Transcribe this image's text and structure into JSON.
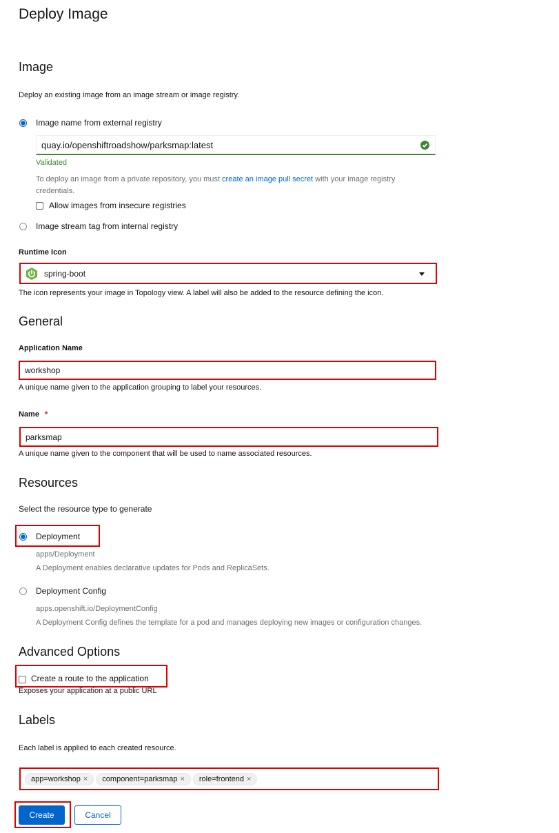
{
  "page": {
    "title": "Deploy Image"
  },
  "image_section": {
    "heading": "Image",
    "description": "Deploy an existing image from an image stream or image registry.",
    "option_external": {
      "label": "Image name from external registry",
      "selected": true
    },
    "image_input": {
      "value": "quay.io/openshiftroadshow/parksmap:latest",
      "status_icon": "check-circle-icon"
    },
    "validated_text": "Validated",
    "private_help_prefix": "To deploy an image from a private repository, you must ",
    "private_help_link": "create an image pull secret",
    "private_help_suffix": " with your image registry credentials.",
    "insecure_checkbox": {
      "label": "Allow images from insecure registries",
      "checked": false
    },
    "option_internal": {
      "label": "Image stream tag from internal registry",
      "selected": false
    },
    "runtime_icon_label": "Runtime Icon",
    "runtime_icon_value": "spring-boot",
    "runtime_icon_help": "The icon represents your image in Topology view. A label will also be added to the resource defining the icon."
  },
  "general_section": {
    "heading": "General",
    "app_name_label": "Application Name",
    "app_name_value": "workshop",
    "app_name_help": "A unique name given to the application grouping to label your resources.",
    "name_label": "Name",
    "name_required": "*",
    "name_value": "parksmap",
    "name_help": "A unique name given to the component that will be used to name associated resources."
  },
  "resources_section": {
    "heading": "Resources",
    "description": "Select the resource type to generate",
    "options": [
      {
        "label": "Deployment",
        "api": "apps/Deployment",
        "description": "A Deployment enables declarative updates for Pods and ReplicaSets.",
        "selected": true
      },
      {
        "label": "Deployment Config",
        "api": "apps.openshift.io/DeploymentConfig",
        "description": "A Deployment Config defines the template for a pod and manages deploying new images or configuration changes.",
        "selected": false
      }
    ]
  },
  "advanced_section": {
    "heading": "Advanced Options",
    "route_checkbox": {
      "label": "Create a route to the application",
      "checked": false
    },
    "route_help": "Exposes your application at a public URL"
  },
  "labels_section": {
    "heading": "Labels",
    "description": "Each label is applied to each created resource.",
    "chips": [
      {
        "label": "app=workshop",
        "remove": "×"
      },
      {
        "label": "component=parksmap",
        "remove": "×"
      },
      {
        "label": "role=frontend",
        "remove": "×"
      }
    ]
  },
  "actions": {
    "create_label": "Create",
    "cancel_label": "Cancel"
  },
  "colors": {
    "primary": "#0066cc",
    "success": "#3e8635",
    "highlight": "#e00000",
    "spring": "#6db33f"
  }
}
